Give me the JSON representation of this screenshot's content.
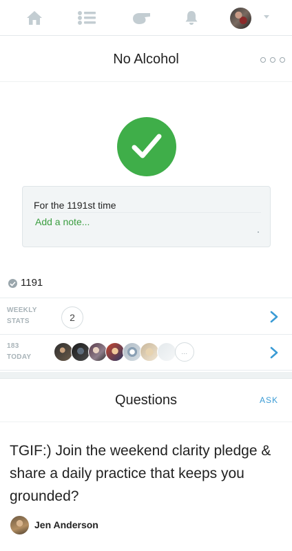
{
  "nav": {
    "items": [
      "home-icon",
      "list-icon",
      "whistle-icon",
      "bell-icon"
    ],
    "accent_color": "#c3cdd2"
  },
  "habit": {
    "title": "No Alcohol",
    "check_color": "#3fae49"
  },
  "note": {
    "count_text": "For the 1191st time",
    "placeholder": "Add a note..."
  },
  "count": {
    "value": "1191"
  },
  "weekly_stats": {
    "label_line1": "WEEKLY",
    "label_line2": "STATS",
    "value": "2"
  },
  "today": {
    "label_line1": "183",
    "label_line2": "TODAY",
    "more_label": "..."
  },
  "questions": {
    "title": "Questions",
    "ask_label": "ASK",
    "question_text": "TGIF:) Join the weekend clarity pledge & share a daily practice that keeps you grounded?",
    "author": "Jen Anderson"
  },
  "colors": {
    "link_green": "#3a9d3f",
    "link_blue": "#3a9bd5"
  }
}
